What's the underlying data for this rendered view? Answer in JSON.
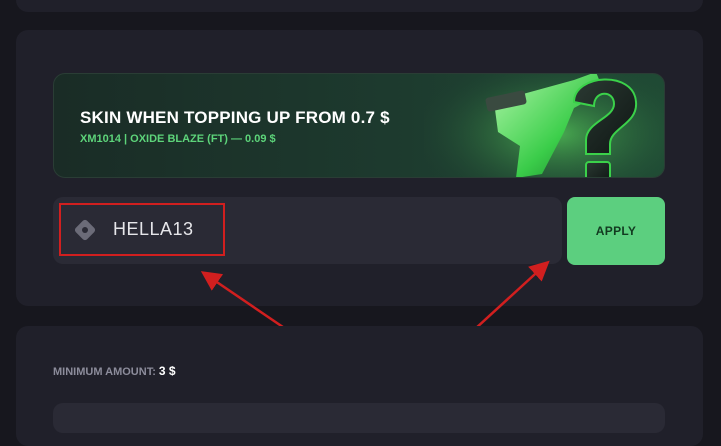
{
  "banner": {
    "title": "SKIN WHEN TOPPING UP FROM 0.7 $",
    "subtitle": "XM1014 | OXIDE BLAZE (FT) — 0.09 $",
    "accent_color": "#5dd47a"
  },
  "promo": {
    "code_value": "HELLA13",
    "icon": "ticket-icon",
    "apply_label": "APPLY",
    "apply_color": "#5ccf7f"
  },
  "amount": {
    "min_label": "MINIMUM AMOUNT:",
    "min_value": "3 $"
  },
  "annotation": {
    "highlight_color": "#d11f1f"
  }
}
